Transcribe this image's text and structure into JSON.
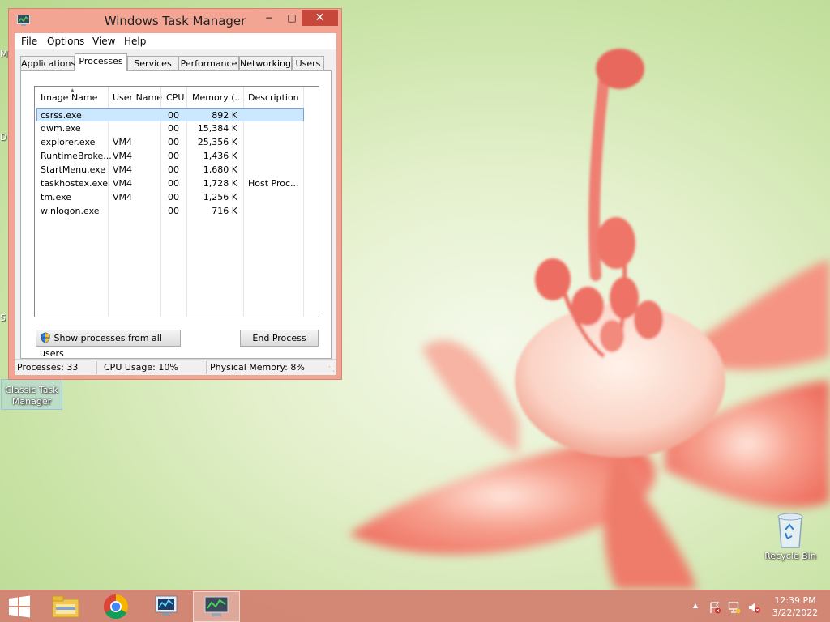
{
  "window": {
    "title": "Windows Task Manager",
    "min_label": "−",
    "max_label": "□",
    "close_label": "✕"
  },
  "menu": [
    "File",
    "Options",
    "View",
    "Help"
  ],
  "tabs": [
    {
      "label": "Applications",
      "active": false
    },
    {
      "label": "Processes",
      "active": true
    },
    {
      "label": "Services",
      "active": false
    },
    {
      "label": "Performance",
      "active": false
    },
    {
      "label": "Networking",
      "active": false
    },
    {
      "label": "Users",
      "active": false
    }
  ],
  "process_table": {
    "sorted_column": "Image Name",
    "headers": [
      "Image Name",
      "User Name",
      "CPU",
      "Memory (...",
      "Description"
    ],
    "rows": [
      {
        "image": "csrss.exe",
        "user": "",
        "cpu": "00",
        "memory": "892 K",
        "description": "",
        "selected": true
      },
      {
        "image": "dwm.exe",
        "user": "",
        "cpu": "00",
        "memory": "15,384 K",
        "description": ""
      },
      {
        "image": "explorer.exe",
        "user": "VM4",
        "cpu": "00",
        "memory": "25,356 K",
        "description": ""
      },
      {
        "image": "RuntimeBroke...",
        "user": "VM4",
        "cpu": "00",
        "memory": "1,436 K",
        "description": ""
      },
      {
        "image": "StartMenu.exe",
        "user": "VM4",
        "cpu": "00",
        "memory": "1,680 K",
        "description": ""
      },
      {
        "image": "taskhostex.exe",
        "user": "VM4",
        "cpu": "00",
        "memory": "1,728 K",
        "description": "Host Proc..."
      },
      {
        "image": "tm.exe",
        "user": "VM4",
        "cpu": "00",
        "memory": "1,256 K",
        "description": ""
      },
      {
        "image": "winlogon.exe",
        "user": "",
        "cpu": "00",
        "memory": "716 K",
        "description": ""
      }
    ]
  },
  "buttons": {
    "show_all": "Show processes from all users",
    "end_process": "End Process"
  },
  "status": {
    "processes": "Processes: 33",
    "cpu": "CPU Usage: 10%",
    "memory": "Physical Memory: 8%"
  },
  "desktop": {
    "classic_tm_label": "Classic Task Manager",
    "recycle_bin_label": "Recycle Bin",
    "edge_letters": [
      "M",
      "D",
      "S"
    ]
  },
  "taskbar": {
    "time": "12:39 PM",
    "date": "3/22/2022",
    "tray_overflow": "▲",
    "pinned": [
      "start-button",
      "file-explorer",
      "chrome",
      "task-manager-shortcut",
      "classic-task-manager"
    ]
  },
  "colors": {
    "window_frame": "#f3a593",
    "taskbar": "#d28070",
    "selection": "#cce8ff",
    "close_button": "#c7483a"
  }
}
